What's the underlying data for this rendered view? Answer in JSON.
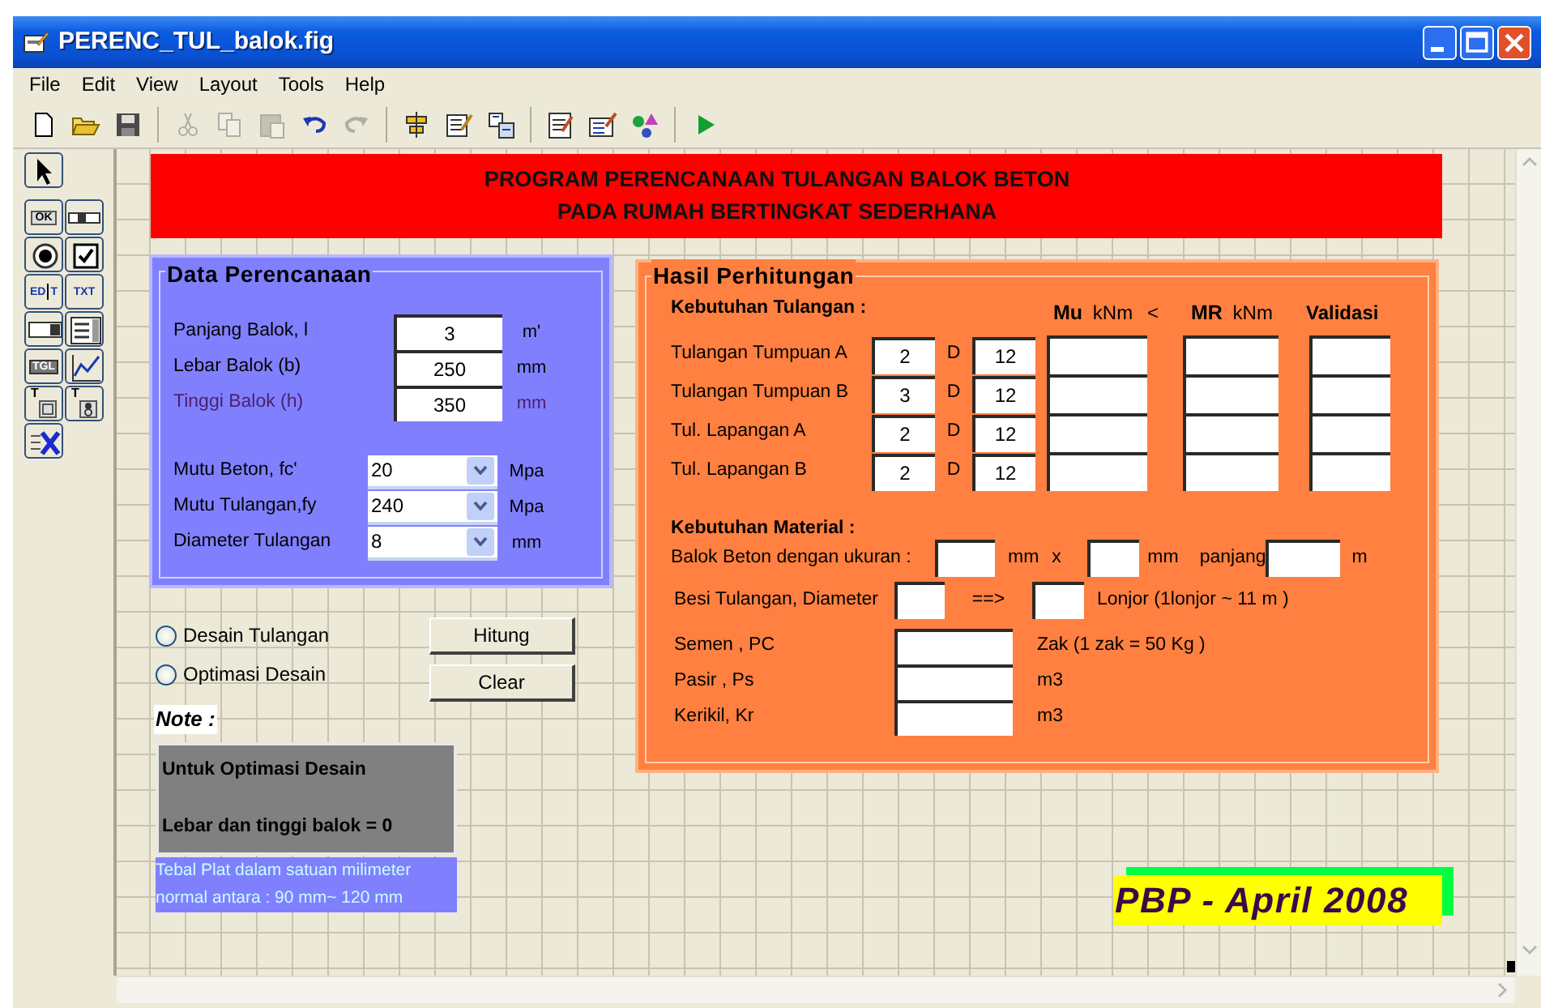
{
  "window": {
    "title": "PERENC_TUL_balok.fig"
  },
  "menu": [
    "File",
    "Edit",
    "View",
    "Layout",
    "Tools",
    "Help"
  ],
  "toolbar": [
    {
      "kind": "new",
      "disabled": false
    },
    {
      "kind": "open",
      "disabled": false
    },
    {
      "kind": "save",
      "disabled": false
    },
    {
      "kind": "separator"
    },
    {
      "kind": "cut",
      "disabled": true
    },
    {
      "kind": "copy",
      "disabled": true
    },
    {
      "kind": "paste",
      "disabled": true
    },
    {
      "kind": "undo",
      "disabled": false
    },
    {
      "kind": "redo",
      "disabled": true
    },
    {
      "kind": "separator"
    },
    {
      "kind": "align",
      "disabled": false
    },
    {
      "kind": "menu_editor",
      "disabled": false
    },
    {
      "kind": "tab_order",
      "disabled": false
    },
    {
      "kind": "separator"
    },
    {
      "kind": "editor",
      "disabled": false
    },
    {
      "kind": "inspector",
      "disabled": false
    },
    {
      "kind": "browser",
      "disabled": false
    },
    {
      "kind": "separator"
    },
    {
      "kind": "run",
      "disabled": false
    }
  ],
  "palette": [
    {
      "kind": "select"
    },
    {
      "kind": "push",
      "label": "OK"
    },
    {
      "kind": "slider"
    },
    {
      "kind": "radio"
    },
    {
      "kind": "checkbox"
    },
    {
      "kind": "edit",
      "label": "ED",
      "label_2": "T"
    },
    {
      "kind": "text",
      "label": "TXT"
    },
    {
      "kind": "popup"
    },
    {
      "kind": "listbox"
    },
    {
      "kind": "toggle",
      "label": "TGL"
    },
    {
      "kind": "axes"
    },
    {
      "kind": "panel",
      "label": "T"
    },
    {
      "kind": "group",
      "label": "T"
    },
    {
      "kind": "activex"
    }
  ],
  "banner": [
    "PROGRAM PERENCANAAN TULANGAN BALOK BETON",
    "PADA RUMAH BERTINGKAT SEDERHANA"
  ],
  "data_panel": {
    "title": "Data Perencanaan",
    "fields": [
      {
        "kind": "edit",
        "label": "Panjang Balok, l",
        "value": "3",
        "unit": "m'",
        "color": "#000000"
      },
      {
        "kind": "edit",
        "label": "Lebar  Balok (b)",
        "value": "250",
        "unit": "mm",
        "color": "#000000"
      },
      {
        "kind": "edit",
        "label": "Tinggi Balok (h)",
        "value": "350",
        "unit": "mm",
        "color": "#4b1f6b"
      },
      {
        "kind": "popup",
        "label": "Mutu Beton, fc'",
        "value": "20",
        "unit": "Mpa",
        "color": "#000000"
      },
      {
        "kind": "popup",
        "label": "Mutu Tulangan,fy",
        "value": "240",
        "unit": "Mpa",
        "color": "#000000"
      },
      {
        "kind": "popup",
        "label": "Diameter Tulangan",
        "value": "8",
        "unit": "mm",
        "color": "#000000"
      }
    ]
  },
  "result_panel": {
    "title": "Hasil Perhitungan",
    "heading": "Kebutuhan Tulangan :",
    "columns": [
      "**Mu** kNm",
      "<",
      "**MR** kNm",
      "Validasi"
    ],
    "rows": [
      {
        "label": "Tulangan Tumpuan A",
        "count": "2",
        "d": "D",
        "diameter": "12"
      },
      {
        "label": "Tulangan Tumpuan B",
        "count": "3",
        "d": "D",
        "diameter": "12"
      },
      {
        "label": "Tul. Lapangan A",
        "count": "2",
        "d": "D",
        "diameter": "12"
      },
      {
        "label": "Tul.  Lapangan B",
        "count": "2",
        "d": "D",
        "diameter": "12"
      }
    ],
    "materials": {
      "heading": "Kebutuhan Material :",
      "beam_label": "Balok Beton dengan ukuran :",
      "unit_1": "mm",
      "times": "x",
      "unit_2": "mm",
      "length_label": "panjang",
      "unit_3": "m",
      "rebar_label": "Besi Tulangan, Diameter",
      "arrow": "==>",
      "rebar_note": "Lonjor  (1lonjor ~ 11 m )",
      "items": [
        {
          "label": "Semen , PC",
          "unit": "Zak  (1 zak = 50 Kg )"
        },
        {
          "label": "Pasir , Ps",
          "unit": "m3"
        },
        {
          "label": "Kerikil, Kr",
          "unit": "m3"
        }
      ]
    }
  },
  "options": [
    {
      "label": "Desain Tulangan",
      "selected": false
    },
    {
      "label": "Optimasi Desain",
      "selected": false
    }
  ],
  "buttons": [
    "Hitung",
    "Clear"
  ],
  "note": {
    "label": "Note :",
    "lines": [
      "Untuk Optimasi Desain",
      "Lebar dan tinggi balok = 0"
    ],
    "info": [
      "Tebal Plat dalam satuan milimeter",
      "normal antara : 90 mm~ 120 mm"
    ]
  },
  "stamp": "PBP - April 2008"
}
